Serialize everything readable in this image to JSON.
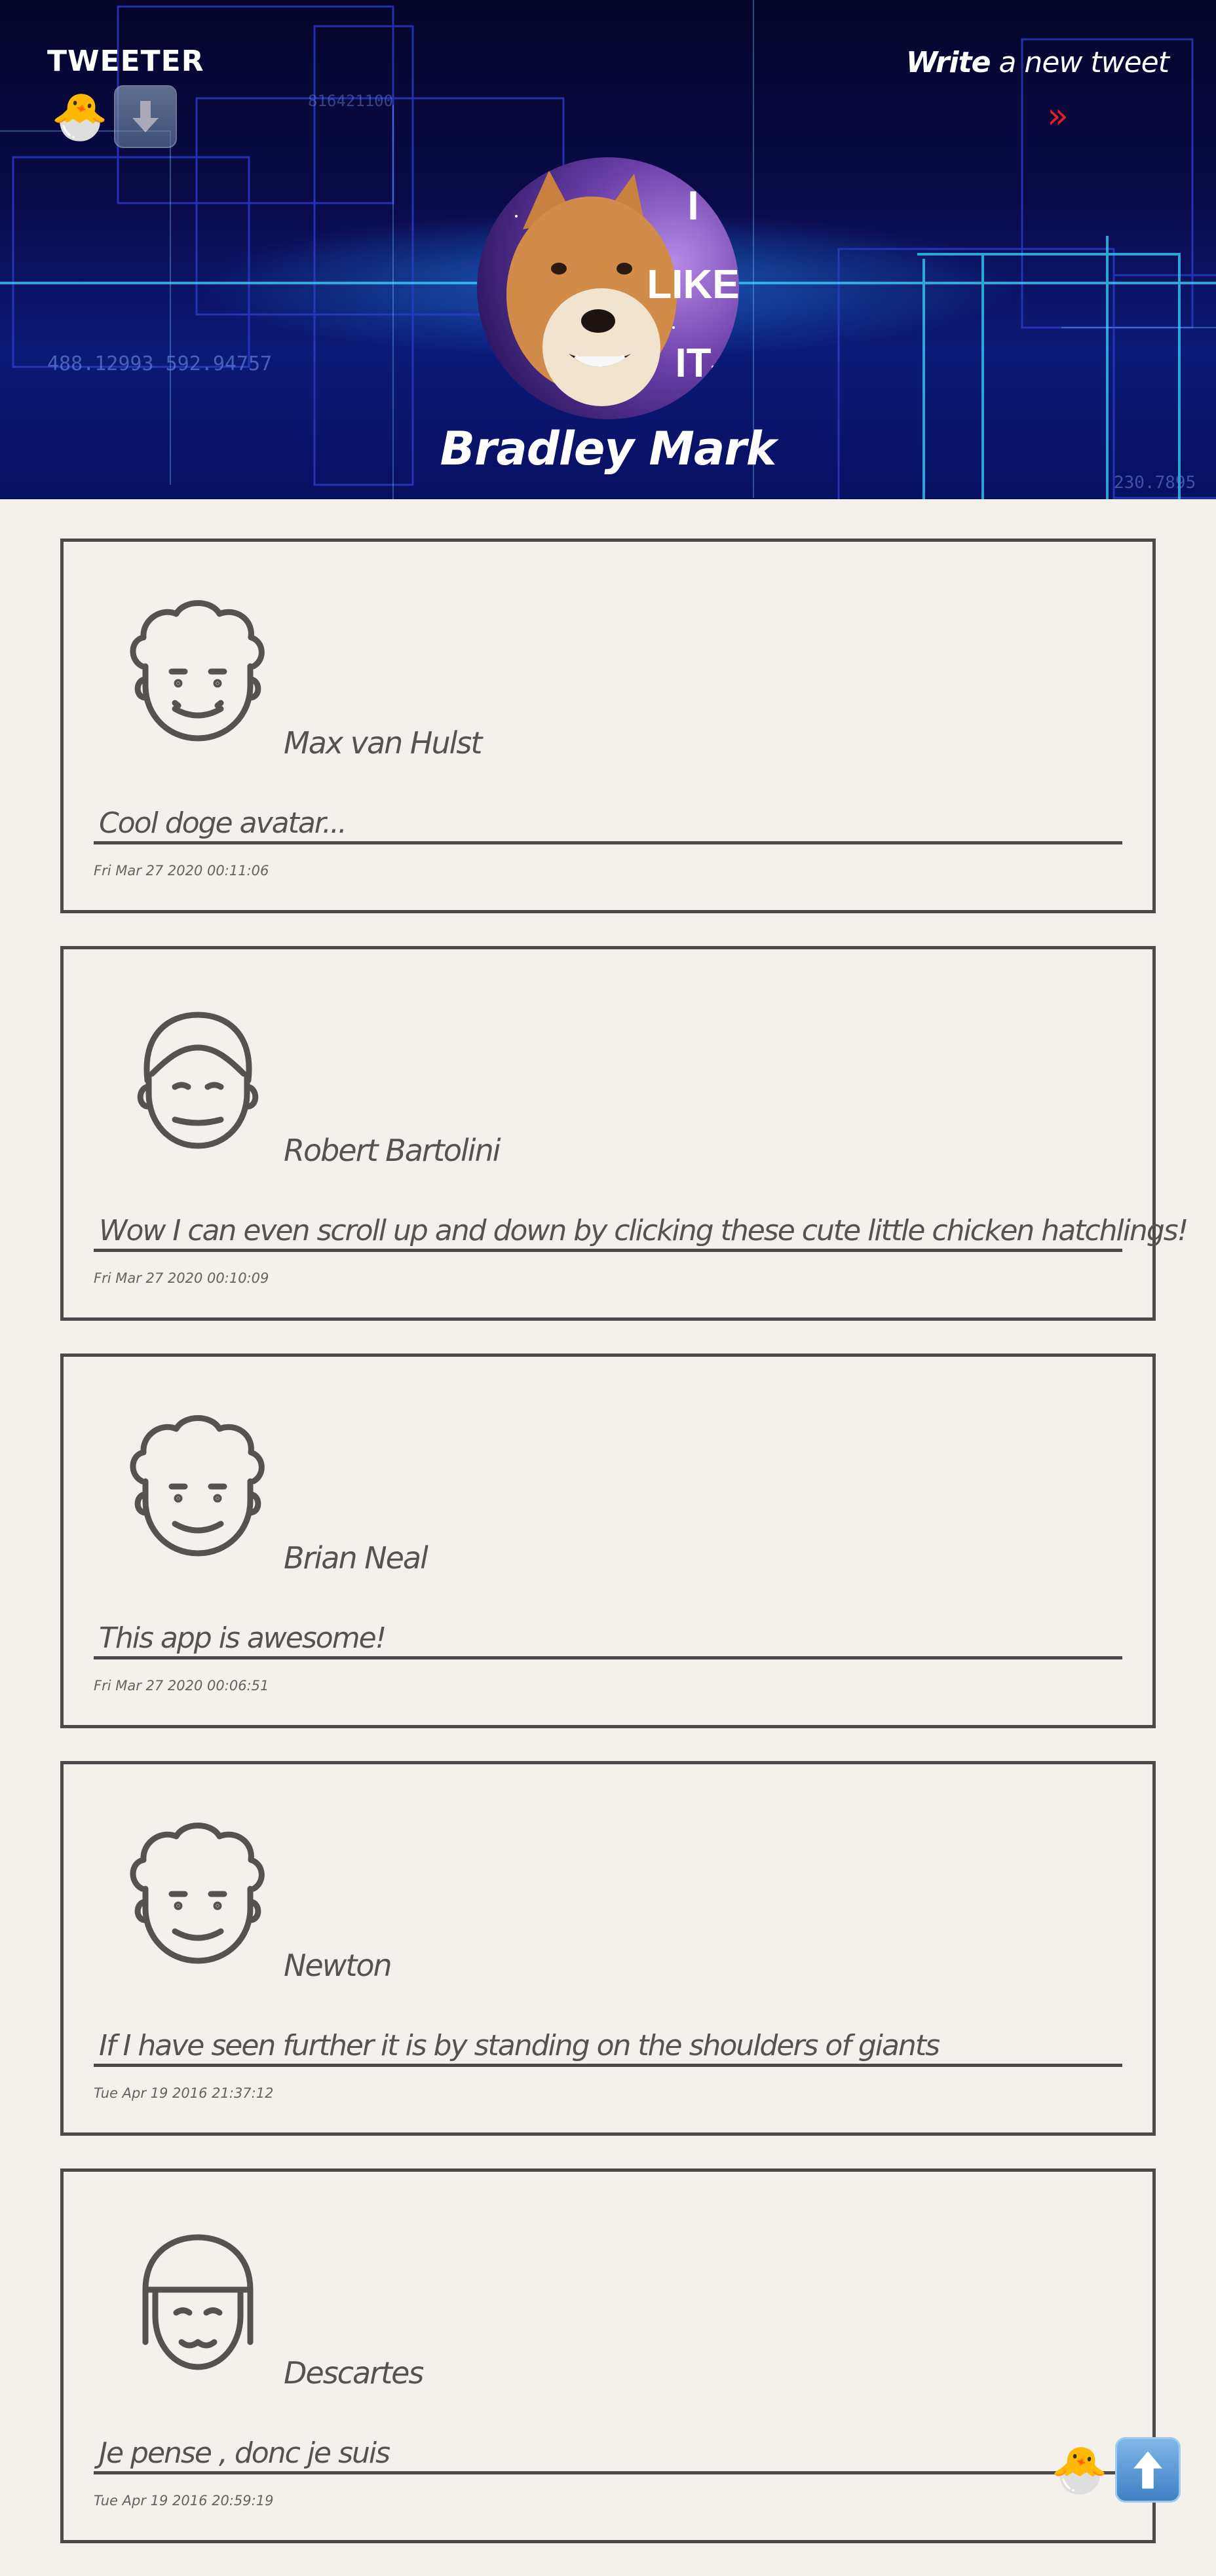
{
  "header": {
    "brand": "TWEETER",
    "write_strong": "Write",
    "write_rest": " a new tweet",
    "go_arrow": "»",
    "profile_name": "Bradley Mark",
    "avatar_caption": [
      "I",
      "LIKE",
      "IT"
    ],
    "bg_numbers": [
      "488.12993 592.94757",
      "230.7895",
      "816421100"
    ],
    "icons": [
      "hatching-chick-icon",
      "down-arrow-icon"
    ]
  },
  "tweets": [
    {
      "author": "Max van Hulst",
      "text": "Cool doge avatar...",
      "date": "Fri Mar 27 2020 00:11:06",
      "avatar": "curly-hair-face"
    },
    {
      "author": "Robert Bartolini",
      "text": "Wow I can even scroll up and down by clicking these cute little chicken hatchlings!",
      "date": "Fri Mar 27 2020 00:10:09",
      "avatar": "short-hair-face"
    },
    {
      "author": "Brian Neal",
      "text": "This app is awesome!",
      "date": "Fri Mar 27 2020 00:06:51",
      "avatar": "curly-hair-face"
    },
    {
      "author": "Newton",
      "text": "If I have seen further it is by standing on the shoulders of giants",
      "date": "Tue Apr 19 2016 21:37:12",
      "avatar": "curly-hair-face"
    },
    {
      "author": "Descartes",
      "text": "Je pense , donc je suis",
      "date": "Tue Apr 19 2016 20:59:19",
      "avatar": "bob-hair-face"
    }
  ],
  "floating": {
    "icons": [
      "hatching-chick-icon",
      "up-arrow-icon"
    ]
  },
  "colors": {
    "page_bg": "#f4f1ed",
    "card_border": "#4a4a4a",
    "text": "#555250",
    "accent_red": "#e02020",
    "hero_bg": "#0a0a4a"
  }
}
